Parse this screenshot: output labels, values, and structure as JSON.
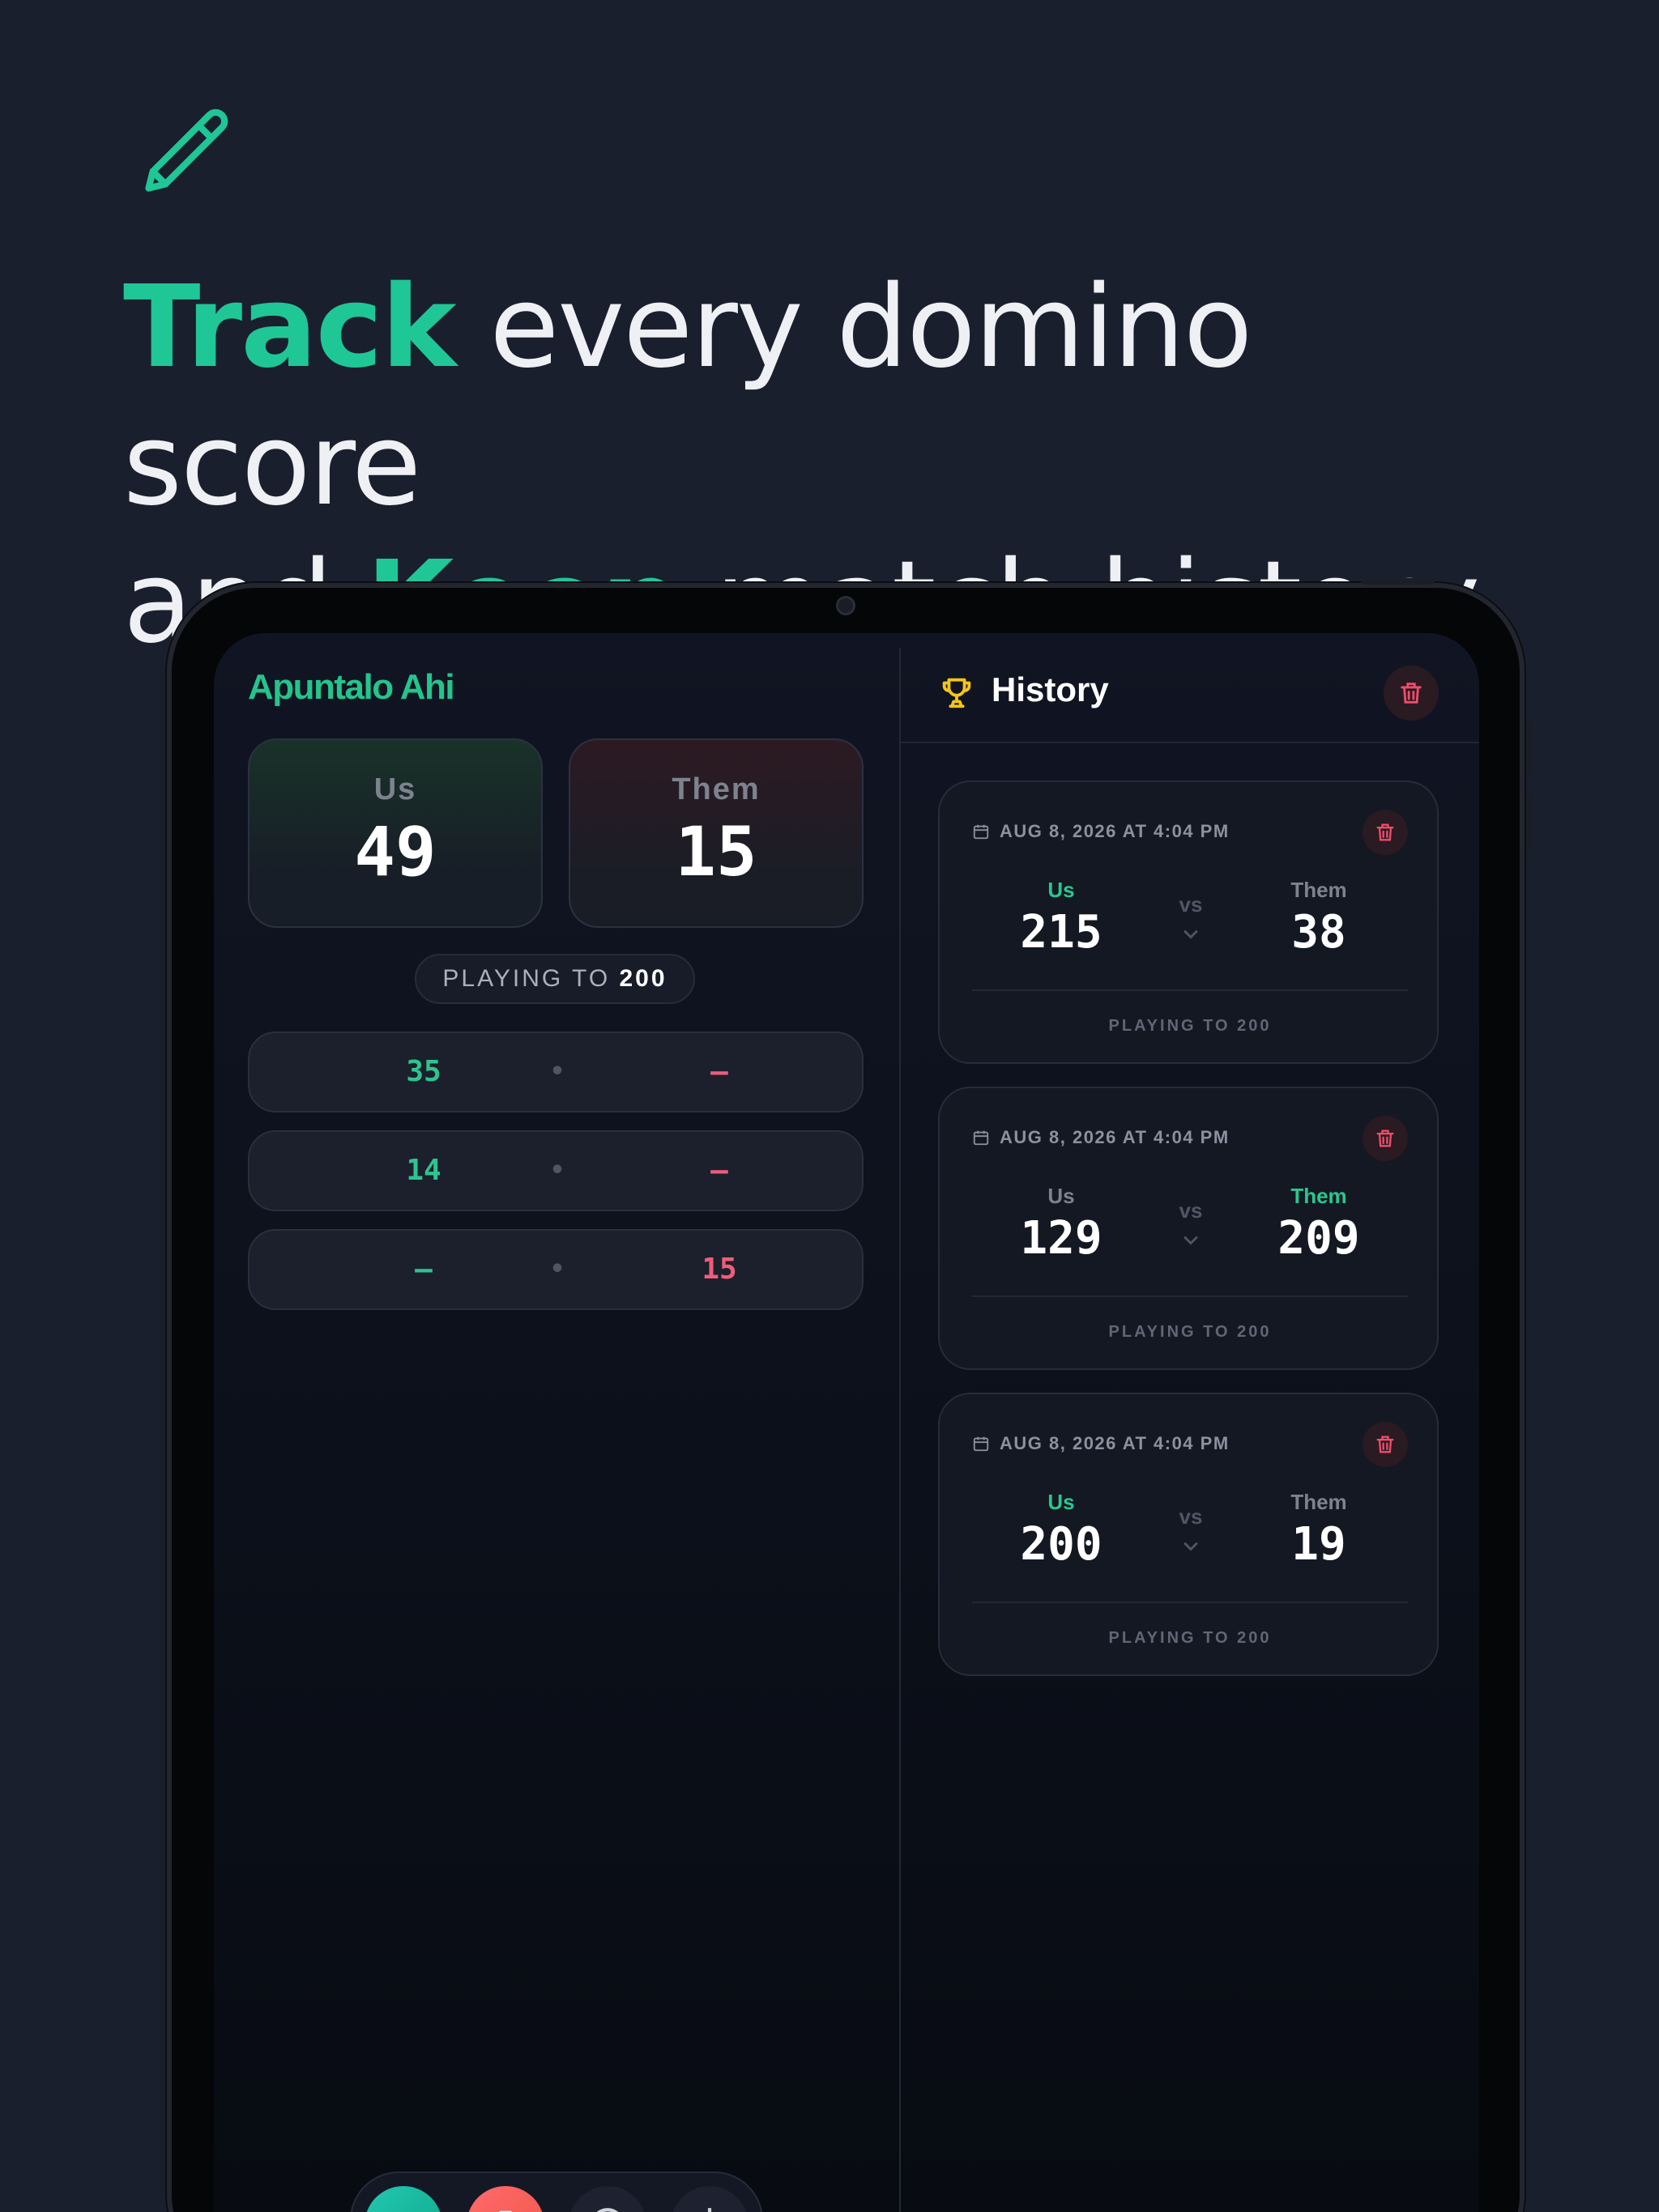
{
  "headline": {
    "line1_accent": "Track",
    "line1_rest": " every domino score",
    "line2_start": "and ",
    "line2_accent": "Keep",
    "line2_rest": " match history"
  },
  "colors": {
    "accent": "#1fc796",
    "danger": "#ef5d7a",
    "trophy": "#f5c518"
  },
  "app": {
    "title": "Apuntalo Ahi",
    "scores": {
      "us_label": "Us",
      "us_value": "49",
      "them_label": "Them",
      "them_value": "15"
    },
    "playing_to_label": "PLAYING TO",
    "playing_to_value": "200",
    "rounds": [
      {
        "us": "35",
        "sep": "•",
        "them": "–"
      },
      {
        "us": "14",
        "sep": "•",
        "them": "–"
      },
      {
        "us": "–",
        "sep": "•",
        "them": "15"
      }
    ],
    "bottom_bar": {
      "icons": [
        "plus-icon",
        "trash-icon",
        "chat-icon",
        "settings-icon"
      ],
      "plus_glyph": "+"
    }
  },
  "history": {
    "title": "History",
    "clear_icon": "trash-icon",
    "matches": [
      {
        "date": "AUG 8, 2026 AT 4:04 PM",
        "us_label": "Us",
        "us_score": "215",
        "them_label": "Them",
        "them_score": "38",
        "vs": "vs",
        "footer": "PLAYING TO 200",
        "winner": "us"
      },
      {
        "date": "AUG 8, 2026 AT 4:04 PM",
        "us_label": "Us",
        "us_score": "129",
        "them_label": "Them",
        "them_score": "209",
        "vs": "vs",
        "footer": "PLAYING TO 200",
        "winner": "them"
      },
      {
        "date": "AUG 8, 2026 AT 4:04 PM",
        "us_label": "Us",
        "us_score": "200",
        "them_label": "Them",
        "them_score": "19",
        "vs": "vs",
        "footer": "PLAYING TO 200",
        "winner": "us"
      }
    ]
  }
}
